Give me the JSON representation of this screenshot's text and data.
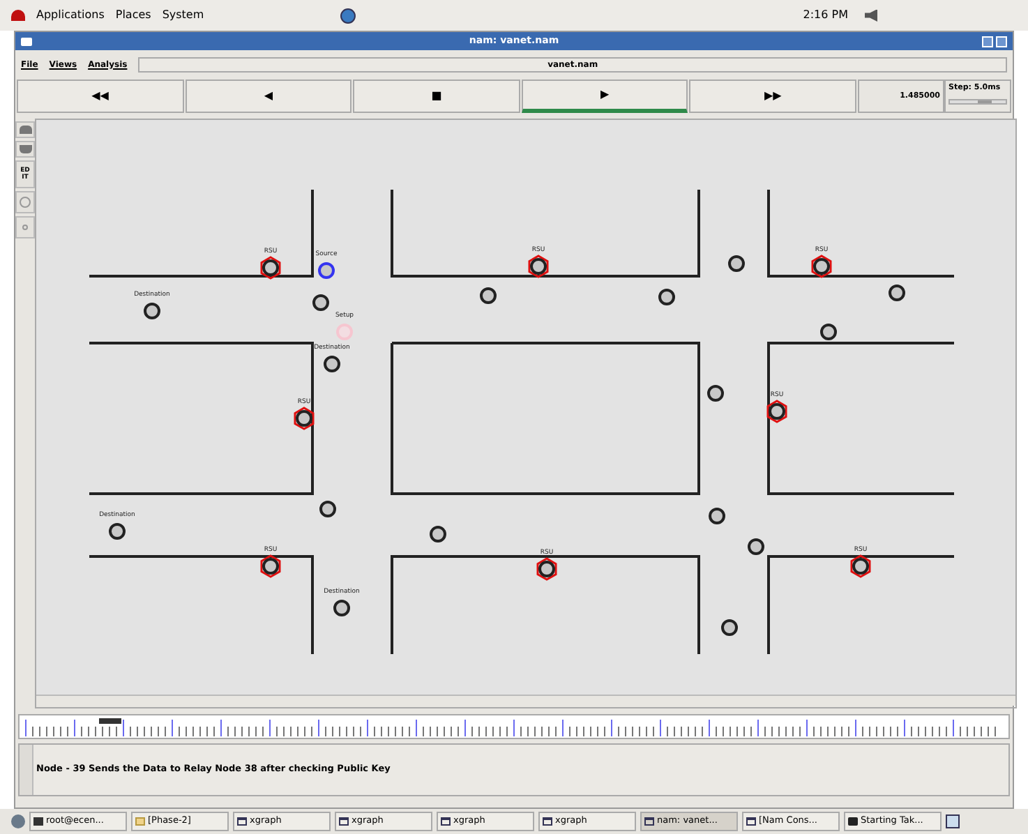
{
  "top_panel": {
    "menus": [
      "Applications",
      "Places",
      "System"
    ],
    "clock": "2:16 PM"
  },
  "window": {
    "title": "nam: vanet.nam"
  },
  "menubar": {
    "items": [
      "File",
      "Views",
      "Analysis"
    ],
    "file_name": "vanet.nam"
  },
  "playback": [
    {
      "symbol": "◀◀",
      "selected": false
    },
    {
      "symbol": "◀",
      "selected": false
    },
    {
      "symbol": "■",
      "selected": false
    },
    {
      "symbol": "▶",
      "selected": true
    },
    {
      "symbol": "▶▶",
      "selected": false
    }
  ],
  "time": "1.485000",
  "step": {
    "label": "Step: 5.0ms",
    "level": 0.6
  },
  "tools": [
    {
      "kind": "zoom-in"
    },
    {
      "kind": "zoom-out"
    },
    {
      "kind": "edit",
      "label": "ED IT"
    },
    {
      "kind": "circle"
    },
    {
      "kind": "dot"
    }
  ],
  "nodes": [
    {
      "kind": "rsu",
      "label": "RSU"
    },
    {
      "kind": "rsu",
      "label": "RSU"
    },
    {
      "kind": "rsu",
      "label": "RSU"
    },
    {
      "kind": "rsu",
      "label": "RSU"
    },
    {
      "kind": "rsu",
      "label": "RSU"
    },
    {
      "kind": "rsu",
      "label": "RSU"
    },
    {
      "kind": "rsu",
      "label": "RSU"
    },
    {
      "kind": "rsu",
      "label": "RSU"
    },
    {
      "kind": "source",
      "label": "Source"
    },
    {
      "kind": "setup",
      "label": "Setup"
    },
    {
      "kind": "destination",
      "label": "Destination"
    },
    {
      "kind": "destination",
      "label": "Destination"
    },
    {
      "kind": "destination",
      "label": "Destination"
    },
    {
      "kind": "destination",
      "label": "Destination"
    },
    {
      "kind": "vehicle"
    },
    {
      "kind": "vehicle"
    },
    {
      "kind": "vehicle"
    },
    {
      "kind": "vehicle"
    },
    {
      "kind": "vehicle"
    },
    {
      "kind": "vehicle"
    },
    {
      "kind": "vehicle"
    },
    {
      "kind": "vehicle"
    },
    {
      "kind": "vehicle"
    },
    {
      "kind": "vehicle"
    },
    {
      "kind": "vehicle"
    },
    {
      "kind": "vehicle"
    }
  ],
  "timeline": {
    "level": 0.08
  },
  "annotation": "Node - 39 Sends the Data to Relay Node 38 after checking Public Key",
  "taskbar": [
    {
      "kind": "terminal",
      "label": "root@ecen...",
      "selected": false
    },
    {
      "kind": "folder",
      "label": "[Phase-2]",
      "selected": false
    },
    {
      "kind": "window",
      "label": "xgraph",
      "selected": false
    },
    {
      "kind": "window",
      "label": "xgraph",
      "selected": false
    },
    {
      "kind": "window",
      "label": "xgraph",
      "selected": false
    },
    {
      "kind": "window",
      "label": "xgraph",
      "selected": false
    },
    {
      "kind": "window",
      "label": "nam: vanet...",
      "selected": true
    },
    {
      "kind": "window",
      "label": "[Nam Cons...",
      "selected": false
    },
    {
      "kind": "app",
      "label": "Starting Tak...",
      "selected": false
    }
  ]
}
